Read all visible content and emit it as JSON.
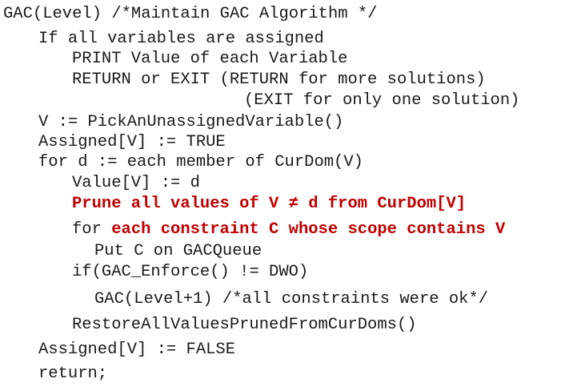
{
  "code": {
    "line_header": "GAC(Level) /*Maintain GAC Algorithm */",
    "line_if_all": "If all variables are assigned",
    "line_print": "PRINT Value of each Variable",
    "line_return_exit": "RETURN or EXIT (RETURN for more solutions)",
    "line_exit_note": "(EXIT for only one solution)",
    "line_pick": "V := PickAnUnassignedVariable()",
    "line_assigned_true": "Assigned[V] := TRUE",
    "line_for_d": "for d := each member of CurDom(V)",
    "line_value": "Value[V] := d",
    "line_prune": "Prune all values of V ≠ d from CurDom[V]",
    "line_for_c_prefix": "for",
    "line_for_c_bold": "each constraint C whose scope contains V",
    "line_put": "Put C on GACQueue",
    "line_if_enforce_pre": "if(GAC",
    "line_if_enforce_post": "Enforce() != DWO)",
    "line_recurse": "GAC(Level+1) /*all constraints were ok*/",
    "line_restore": "RestoreAllValuesPrunedFromCurDoms()",
    "line_assigned_false": "Assigned[V] := FALSE",
    "line_return": "return;"
  }
}
